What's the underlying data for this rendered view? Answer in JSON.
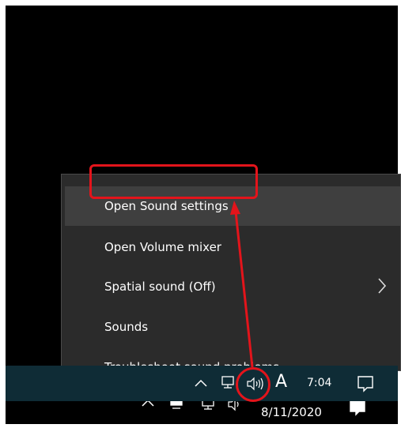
{
  "context_menu": {
    "items": [
      {
        "label": "Open Sound settings"
      },
      {
        "label": "Open Volume mixer"
      },
      {
        "label": "Spatial sound (Off)"
      },
      {
        "label": "Sounds"
      },
      {
        "label": "Troubleshoot sound problems"
      }
    ]
  },
  "taskbar": {
    "primary": {
      "input_indicator": "A",
      "time": "7:04"
    },
    "secondary": {
      "date": "8/11/2020"
    }
  },
  "icons": {
    "chevron": "chevron-up-icon",
    "network": "network-icon",
    "volume": "speaker-volume-icon",
    "notifications": "action-center-icon",
    "submenu": "chevron-right-icon"
  },
  "colors": {
    "menu_background": "#2b2b2b",
    "menu_hover": "#3f3f3f",
    "taskbar": "#0f2c36",
    "annotation": "#e3141b"
  }
}
